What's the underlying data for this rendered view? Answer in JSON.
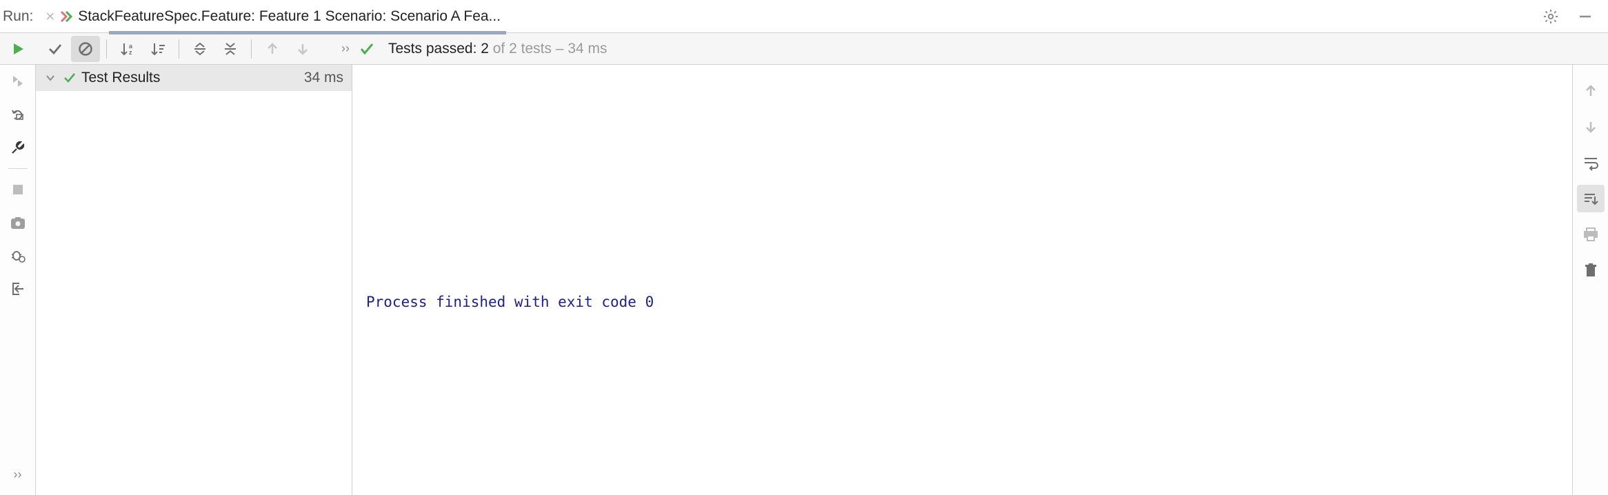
{
  "header": {
    "run_label": "Run:",
    "tab_title": "StackFeatureSpec.Feature: Feature 1 Scenario: Scenario A Fea..."
  },
  "status": {
    "prefix": "Tests passed: ",
    "passed_count": "2",
    "of_text": " of 2 tests",
    "time_sep": " – ",
    "time": "34 ms"
  },
  "tree": {
    "root_label": "Test Results",
    "root_time": "34 ms"
  },
  "console": {
    "line": "Process finished with exit code 0"
  }
}
